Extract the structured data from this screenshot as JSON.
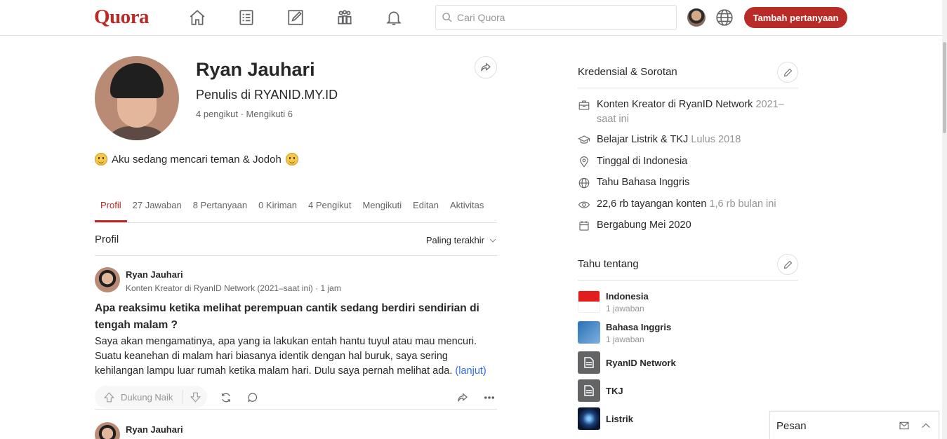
{
  "brand": {
    "logo": "Quora",
    "accent": "#b92b27"
  },
  "nav": {
    "items": [
      "home-icon",
      "answer-list-icon",
      "edit-icon",
      "spaces-icon",
      "bell-icon"
    ],
    "search_placeholder": "Cari Quora",
    "add_question": "Tambah pertanyaan"
  },
  "profile": {
    "name": "Ryan Jauhari",
    "headline": "Penulis di RYANID.MY.ID",
    "follow_line": "4 pengikut · Mengikuti 6",
    "bio": "Aku sedang mencari teman & Jodoh"
  },
  "tabs": [
    "Profil",
    "27 Jawaban",
    "8 Pertanyaan",
    "0 Kiriman",
    "4 Pengikut",
    "Mengikuti",
    "Editan",
    "Aktivitas"
  ],
  "section": {
    "title": "Profil",
    "sort": "Paling terakhir"
  },
  "post": {
    "author": "Ryan Jauhari",
    "credential": "Konten Kreator di RyanID Network (2021–saat ini) · 1 jam",
    "question": "Apa reaksimu ketika melihat perempuan cantik sedang berdiri sendirian di tengah malam ?",
    "body": "Saya akan mengamatinya, apa yang ia lakukan entah hantu tuyul atau mau mencuri. Suatu keanehan di malam hari biasanya identik dengan hal buruk, saya sering kehilangan lampu luar rumah ketika malam hari. Dulu saya pernah melihat ada.",
    "more": "(lanjut)",
    "upvote": "Dukung Naik"
  },
  "post2": {
    "author": "Ryan Jauhari"
  },
  "credentials": {
    "title": "Kredensial & Sorotan",
    "items": [
      {
        "icon": "briefcase-icon",
        "text": "Konten Kreator di RyanID Network",
        "muted": "2021–saat ini"
      },
      {
        "icon": "graduation-cap-icon",
        "text": "Belajar Listrik & TKJ",
        "muted": "Lulus 2018"
      },
      {
        "icon": "location-icon",
        "text": "Tinggal di Indonesia",
        "muted": ""
      },
      {
        "icon": "globe-icon",
        "text": "Tahu Bahasa Inggris",
        "muted": ""
      },
      {
        "icon": "eye-icon",
        "text": "22,6 rb tayangan konten",
        "muted": "1,6 rb bulan ini"
      },
      {
        "icon": "calendar-icon",
        "text": "Bergabung Mei 2020",
        "muted": ""
      }
    ]
  },
  "knows_about": {
    "title": "Tahu tentang",
    "topics": [
      {
        "name": "Indonesia",
        "count": "1 jawaban"
      },
      {
        "name": "Bahasa Inggris",
        "count": "1 jawaban"
      },
      {
        "name": "RyanID Network",
        "count": ""
      },
      {
        "name": "TKJ",
        "count": ""
      },
      {
        "name": "Listrik",
        "count": ""
      }
    ]
  },
  "messages": {
    "label": "Pesan"
  }
}
